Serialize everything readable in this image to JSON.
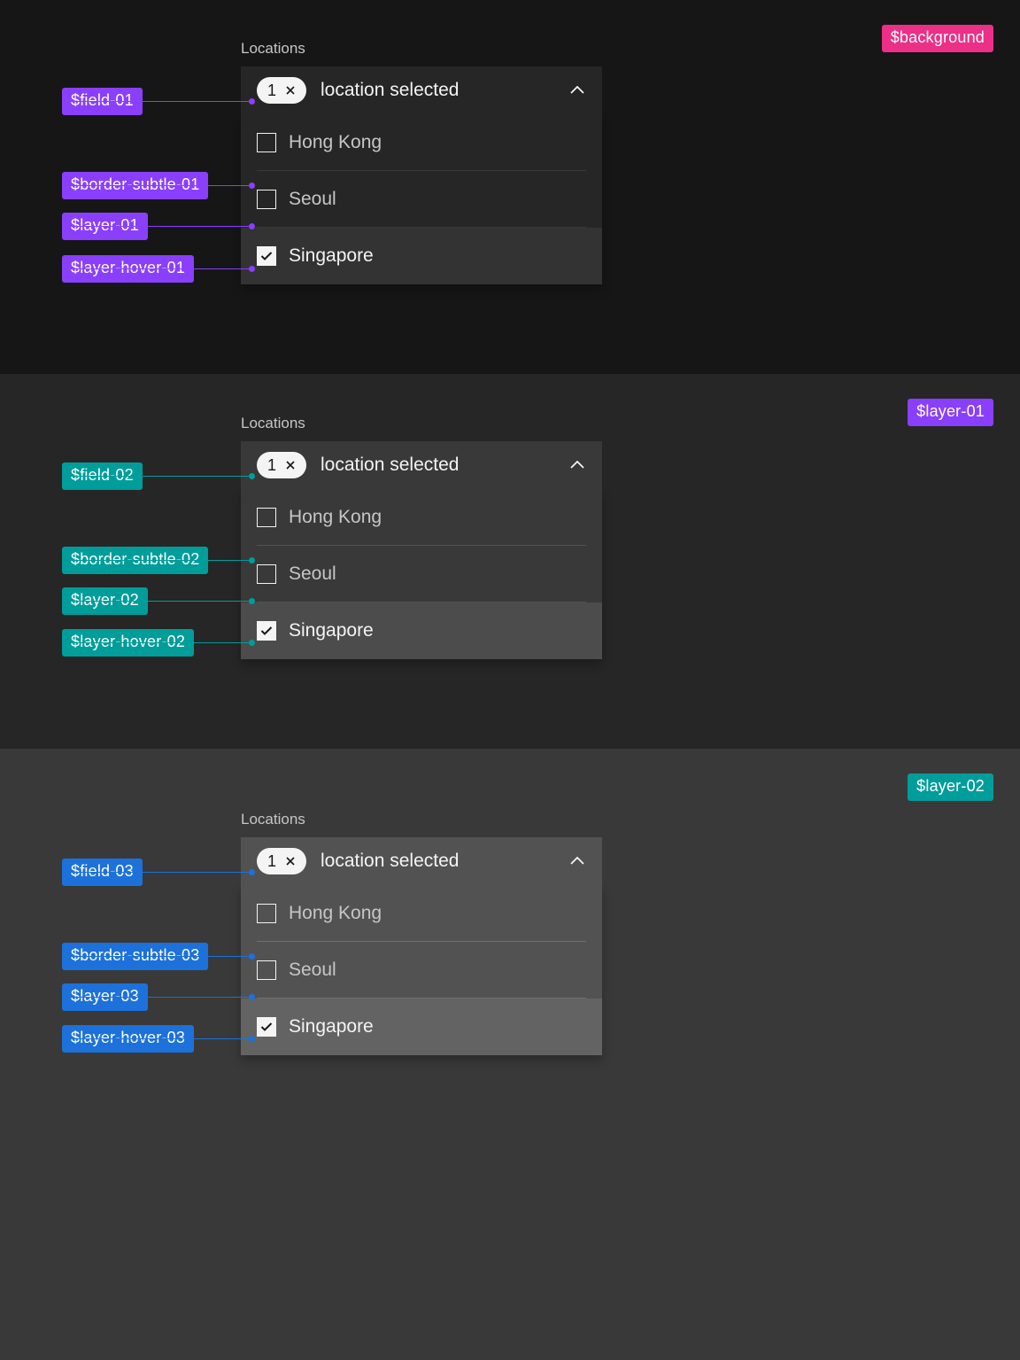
{
  "colors": {
    "background": "#161616",
    "layer01": "#262626",
    "layer02": "#393939",
    "pink": "#ec2f87",
    "purple": "#8a3ffc",
    "teal": "#009d9a",
    "blue": "#1d71da"
  },
  "dropdown": {
    "label": "Locations",
    "count": "1",
    "text": "location selected",
    "options": [
      "Hong Kong",
      "Seoul",
      "Singapore"
    ],
    "selectedIndex": 2
  },
  "sections": [
    {
      "cornerTag": "$background",
      "cornerColor": "pink",
      "accent": "purple",
      "callouts": [
        {
          "label": "$field-01",
          "target": "field"
        },
        {
          "label": "$border-subtle-01",
          "target": "border"
        },
        {
          "label": "$layer-01",
          "target": "layer"
        },
        {
          "label": "$layer-hover-01",
          "target": "hover"
        }
      ]
    },
    {
      "cornerTag": "$layer-01",
      "cornerColor": "purple",
      "accent": "teal",
      "callouts": [
        {
          "label": "$field-02",
          "target": "field"
        },
        {
          "label": "$border-subtle-02",
          "target": "border"
        },
        {
          "label": "$layer-02",
          "target": "layer"
        },
        {
          "label": "$layer-hover-02",
          "target": "hover"
        }
      ]
    },
    {
      "cornerTag": "$layer-02",
      "cornerColor": "teal",
      "accent": "blue",
      "callouts": [
        {
          "label": "$field-03",
          "target": "field"
        },
        {
          "label": "$border-subtle-03",
          "target": "border"
        },
        {
          "label": "$layer-03",
          "target": "layer"
        },
        {
          "label": "$layer-hover-03",
          "target": "hover"
        }
      ]
    }
  ]
}
